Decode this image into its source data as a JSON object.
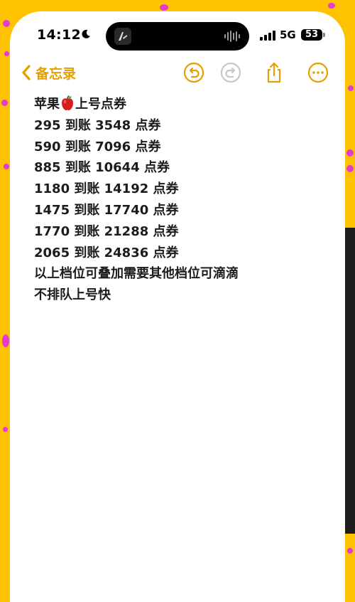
{
  "status_bar": {
    "time": "14:12",
    "network": "5G",
    "battery": "53"
  },
  "nav": {
    "back_label": "备忘录"
  },
  "note": {
    "lines": [
      {
        "before": "苹果",
        "emoji": "apple-emoji",
        "after": "上号点券"
      },
      {
        "text": "295 到账 3548 点券"
      },
      {
        "text": "590 到账 7096 点券"
      },
      {
        "text": "885 到账 10644 点券"
      },
      {
        "text": "1180 到账 14192 点券"
      },
      {
        "text": "1475 到账 17740 点券"
      },
      {
        "text": "1770 到账 21288 点券"
      },
      {
        "text": "2065 到账 24836 点券"
      },
      {
        "text": "以上档位可叠加需要其他档位可滴滴"
      },
      {
        "text": "不排队上号快"
      }
    ]
  },
  "colors": {
    "accent": "#e5a000",
    "background": "#ffc200",
    "confetti": "#e23bd0"
  },
  "icons": [
    "moon-icon",
    "signal-icon",
    "back-chevron-icon",
    "undo-icon",
    "redo-icon",
    "share-icon",
    "more-icon",
    "apple-emoji"
  ]
}
